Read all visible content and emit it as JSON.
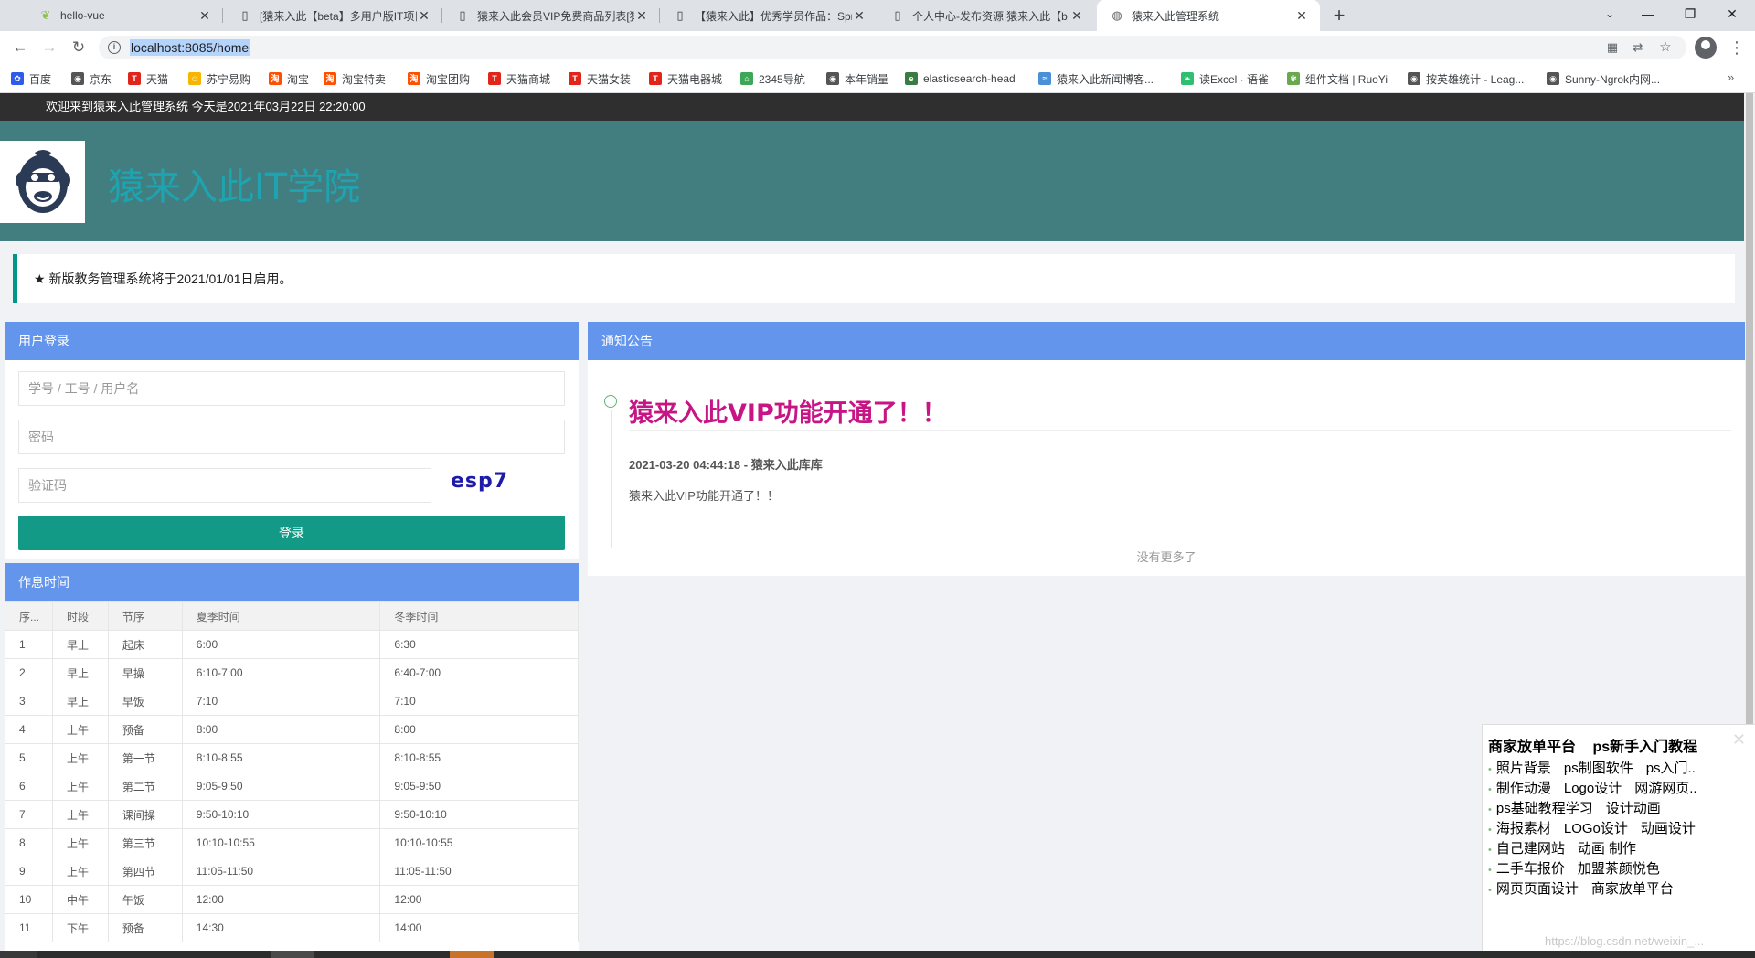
{
  "browser": {
    "tabs": [
      {
        "title": "hello-vue",
        "icon": "vue-leaf-icon"
      },
      {
        "title": "[猿来入此【beta】多用户版IT项目",
        "icon": "page-icon"
      },
      {
        "title": "猿来入此会员VIP免费商品列表[猿",
        "icon": "page-icon"
      },
      {
        "title": "【猿来入此】优秀学员作品：Spr",
        "icon": "page-icon"
      },
      {
        "title": "个人中心-发布资源|猿来入此【b",
        "icon": "page-icon"
      },
      {
        "title": "猿来入此管理系统",
        "icon": "globe-icon"
      }
    ],
    "new_tab": "+",
    "window_controls": {
      "minimize": "—",
      "maximize": "❐",
      "close": "✕"
    },
    "url": "localhost:8085/home",
    "bookmarks": [
      {
        "label": "百度",
        "color": "#2f5bea",
        "glyph": "✿"
      },
      {
        "label": "京东",
        "color": "#555555",
        "glyph": "◉"
      },
      {
        "label": "天猫",
        "color": "#e1251b",
        "glyph": "T"
      },
      {
        "label": "苏宁易购",
        "color": "#f7b500",
        "glyph": "☺"
      },
      {
        "label": "淘宝",
        "color": "#ff5000",
        "glyph": "淘"
      },
      {
        "label": "淘宝特卖",
        "color": "#ff5000",
        "glyph": "淘"
      },
      {
        "label": "淘宝团购",
        "color": "#ff5000",
        "glyph": "淘"
      },
      {
        "label": "天猫商城",
        "color": "#e1251b",
        "glyph": "T"
      },
      {
        "label": "天猫女装",
        "color": "#e1251b",
        "glyph": "T"
      },
      {
        "label": "天猫电器城",
        "color": "#e1251b",
        "glyph": "T"
      },
      {
        "label": "2345导航",
        "color": "#3aa856",
        "glyph": "⌂"
      },
      {
        "label": "本年销量",
        "color": "#555555",
        "glyph": "◉"
      },
      {
        "label": "elasticsearch-head",
        "color": "#3a7d44",
        "glyph": "e"
      },
      {
        "label": "猿来入此新闻博客...",
        "color": "#4a90d9",
        "glyph": "≈"
      },
      {
        "label": "读Excel · 语雀",
        "color": "#2fbf71",
        "glyph": "❧"
      },
      {
        "label": "组件文档 | RuoYi",
        "color": "#6aa84f",
        "glyph": "✾"
      },
      {
        "label": "按英雄统计 - Leag...",
        "color": "#555555",
        "glyph": "◉"
      },
      {
        "label": "Sunny-Ngrok内网...",
        "color": "#555555",
        "glyph": "◉"
      }
    ],
    "bookmarks_more": "»"
  },
  "site": {
    "welcome": "欢迎来到猿来入此管理系统   今天是2021年03月22日 22:20:00",
    "title": "猿来入此IT学院",
    "announcement": "★ 新版教务管理系统将于2021/01/01日启用。"
  },
  "login": {
    "header": "用户登录",
    "username_placeholder": "学号 / 工号 / 用户名",
    "password_placeholder": "密码",
    "captcha_placeholder": "验证码",
    "captcha_text": "esp7",
    "submit": "登录"
  },
  "schedule": {
    "header": "作息时间",
    "columns": [
      "序...",
      "时段",
      "节序",
      "夏季时间",
      "冬季时间"
    ],
    "rows": [
      [
        "1",
        "早上",
        "起床",
        "6:00",
        "6:30"
      ],
      [
        "2",
        "早上",
        "早操",
        "6:10-7:00",
        "6:40-7:00"
      ],
      [
        "3",
        "早上",
        "早饭",
        "7:10",
        "7:10"
      ],
      [
        "4",
        "上午",
        "预备",
        "8:00",
        "8:00"
      ],
      [
        "5",
        "上午",
        "第一节",
        "8:10-8:55",
        "8:10-8:55"
      ],
      [
        "6",
        "上午",
        "第二节",
        "9:05-9:50",
        "9:05-9:50"
      ],
      [
        "7",
        "上午",
        "课间操",
        "9:50-10:10",
        "9:50-10:10"
      ],
      [
        "8",
        "上午",
        "第三节",
        "10:10-10:55",
        "10:10-10:55"
      ],
      [
        "9",
        "上午",
        "第四节",
        "11:05-11:50",
        "11:05-11:50"
      ],
      [
        "10",
        "中午",
        "午饭",
        "12:00",
        "12:00"
      ],
      [
        "11",
        "下午",
        "预备",
        "14:30",
        "14:00"
      ]
    ]
  },
  "notices": {
    "header": "通知公告",
    "items": [
      {
        "title": "猿来入此VIP功能开通了！！",
        "meta": "2021-03-20 04:44:18 - 猿来入此库库",
        "body": "猿来入此VIP功能开通了！！"
      }
    ],
    "no_more": "没有更多了"
  },
  "ad": {
    "close": "✕",
    "header": [
      "商家放单平台",
      "ps新手入门教程"
    ],
    "rows": [
      [
        "照片背景",
        "ps制图软件",
        "ps入门.."
      ],
      [
        "制作动漫",
        "Logo设计",
        "网游网页.."
      ],
      [
        "ps基础教程学习",
        "设计动画"
      ],
      [
        "海报素材",
        "LOGo设计",
        "动画设计"
      ],
      [
        "自己建网站",
        "动画 制作"
      ],
      [
        "二手车报价",
        "加盟茶颜悦色"
      ],
      [
        "网页页面设计",
        "商家放单平台"
      ]
    ]
  },
  "watermark": "https://blog.csdn.net/weixin_..."
}
